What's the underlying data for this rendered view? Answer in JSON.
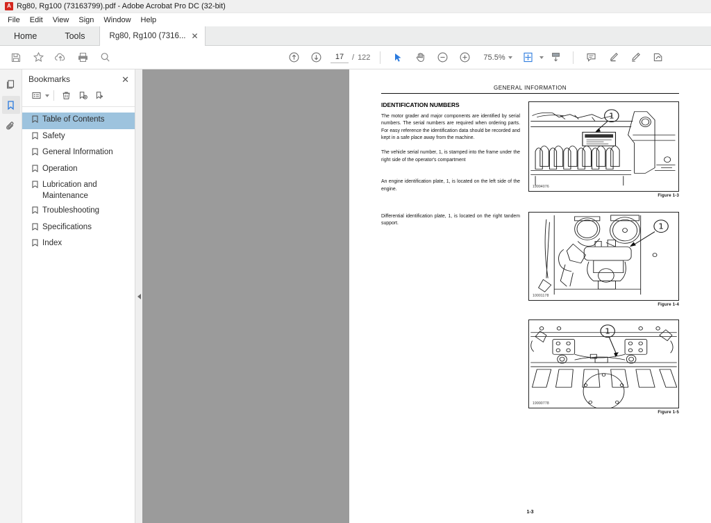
{
  "window": {
    "title": "Rg80, Rg100 (73163799).pdf - Adobe Acrobat Pro DC (32-bit)",
    "app_icon": "acrobat-icon"
  },
  "menubar": {
    "items": [
      {
        "label": "File"
      },
      {
        "label": "Edit"
      },
      {
        "label": "View"
      },
      {
        "label": "Sign"
      },
      {
        "label": "Window"
      },
      {
        "label": "Help"
      }
    ]
  },
  "tabbar": {
    "home_label": "Home",
    "tools_label": "Tools",
    "document_tab": {
      "label": "Rg80, Rg100 (7316...",
      "close_label": "✕"
    }
  },
  "toolbar": {
    "left_icons": [
      {
        "name": "save-icon",
        "tooltip": "Save"
      },
      {
        "name": "star-icon",
        "tooltip": "Add to favorites"
      },
      {
        "name": "upload-cloud-icon",
        "tooltip": "Send file"
      },
      {
        "name": "print-icon",
        "tooltip": "Print"
      },
      {
        "name": "search-icon",
        "tooltip": "Find"
      }
    ],
    "page_up_icon": "arrow-up-circle-icon",
    "page_down_icon": "arrow-down-circle-icon",
    "page_current": "17",
    "page_separator": "/",
    "page_total": "122",
    "select_tool_icon": "cursor-arrow-icon",
    "hand_tool_icon": "hand-icon",
    "zoom_out_icon": "minus-circle-icon",
    "zoom_in_icon": "plus-circle-icon",
    "zoom_value": "75.5%",
    "right_icons": [
      {
        "name": "page-fit-icon",
        "tooltip": "Fit page"
      },
      {
        "name": "scroll-mode-icon",
        "tooltip": "Scroll mode"
      },
      {
        "name": "comment-icon",
        "tooltip": "Add comment"
      },
      {
        "name": "highlight-icon",
        "tooltip": "Highlight text"
      },
      {
        "name": "draw-icon",
        "tooltip": "Draw"
      },
      {
        "name": "sign-icon",
        "tooltip": "Fill and sign"
      }
    ]
  },
  "rail": {
    "items": [
      {
        "name": "page-thumbnails-icon",
        "active": false
      },
      {
        "name": "bookmarks-icon",
        "active": true
      },
      {
        "name": "attachments-icon",
        "active": false
      }
    ]
  },
  "bookmarks_panel": {
    "title": "Bookmarks",
    "close_label": "✕",
    "tools": [
      {
        "name": "bookmark-options-icon"
      },
      {
        "name": "delete-bookmark-icon"
      },
      {
        "name": "new-bookmark-icon"
      },
      {
        "name": "edit-bookmark-icon"
      }
    ],
    "items": [
      {
        "label": "Table of Contents",
        "selected": true
      },
      {
        "label": "Safety",
        "selected": false
      },
      {
        "label": "General Information",
        "selected": false
      },
      {
        "label": "Operation",
        "selected": false
      },
      {
        "label": "Lubrication and Maintenance",
        "selected": false
      },
      {
        "label": "Troubleshooting",
        "selected": false
      },
      {
        "label": "Specifications",
        "selected": false
      },
      {
        "label": "Index",
        "selected": false
      }
    ]
  },
  "viewer": {
    "collapse_handle_icon": "chevron-left-icon",
    "background_color": "#9b9b9b"
  },
  "document": {
    "running_header": "GENERAL INFORMATION",
    "section_title": "IDENTIFICATION NUMBERS",
    "paragraphs": [
      "The motor grader and major components are identified by serial numbers. The serial numbers are required when ordering parts. For easy reference the identification data should be recorded and kept in a safe place away from the machine.",
      "The vehicle serial number, 1, is stamped into the frame under the right side of the operator's compartment",
      "An engine identification plate, 1, is located on the left side of the engine.",
      "Differential identification plate, 1, is located on the right tandem support."
    ],
    "figures": [
      {
        "caption": "Figure 1-3",
        "drawing_number": "19994076",
        "callout": "1",
        "subject": "vehicle-serial-number-frame"
      },
      {
        "caption": "Figure 1-4",
        "drawing_number": "10001178",
        "callout": "1",
        "subject": "engine-identification-plate"
      },
      {
        "caption": "Figure 1-5",
        "drawing_number": "19990778",
        "callout": "1",
        "subject": "differential-identification-plate"
      }
    ],
    "page_footer": "1-3"
  }
}
